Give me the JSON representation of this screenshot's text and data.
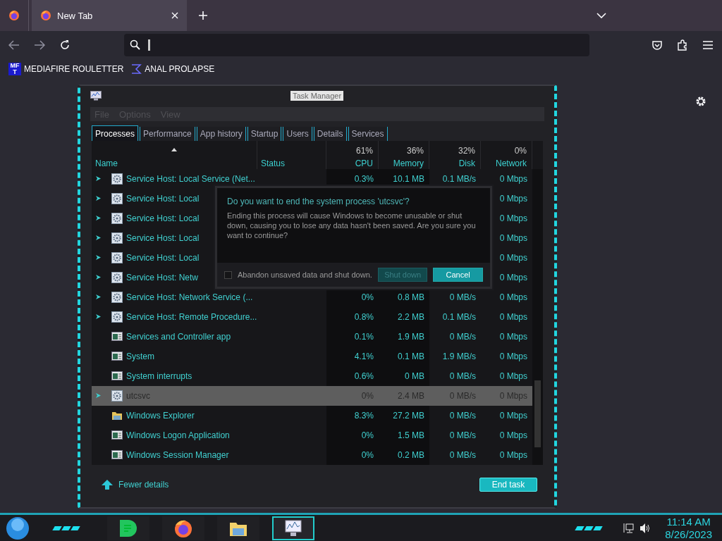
{
  "browser": {
    "tabs": [
      {
        "label": "New Tab",
        "selected": true
      }
    ],
    "bookmarks": [
      {
        "label": "MEDIAFIRE ROULETTER",
        "kind": "mft",
        "icon_text": [
          "MF",
          "T"
        ]
      },
      {
        "label": "ANAL PROLAPSE",
        "kind": "sigma"
      }
    ]
  },
  "task_manager": {
    "title": "Task Manager",
    "menu": [
      "File",
      "Options",
      "View"
    ],
    "tabs": [
      {
        "label": "Processes",
        "selected": true
      },
      {
        "label": "Performance",
        "selected": false
      },
      {
        "label": "App history",
        "selected": false
      },
      {
        "label": "Startup",
        "selected": false
      },
      {
        "label": "Users",
        "selected": false
      },
      {
        "label": "Details",
        "selected": false
      },
      {
        "label": "Services",
        "selected": false
      }
    ],
    "columns": [
      {
        "label": "Name",
        "sorted": true
      },
      {
        "label": "Status",
        "sorted": false
      },
      {
        "label": "CPU",
        "usage": "61%",
        "sorted": false
      },
      {
        "label": "Memory",
        "usage": "36%",
        "sorted": false
      },
      {
        "label": "Disk",
        "usage": "32%",
        "sorted": false
      },
      {
        "label": "Network",
        "usage": "0%",
        "sorted": false
      }
    ],
    "rows": [
      {
        "name": "Service Host: Local Service (Net...",
        "kind": "service",
        "expandable": true,
        "selected": false,
        "cpu": "0.3%",
        "memory": "10.1 MB",
        "disk": "0.1 MB/s",
        "network": "0 Mbps"
      },
      {
        "name": "Service Host: Local",
        "kind": "service",
        "expandable": true,
        "selected": false,
        "network": "0 Mbps"
      },
      {
        "name": "Service Host: Local",
        "kind": "service",
        "expandable": true,
        "selected": false,
        "network": "0 Mbps"
      },
      {
        "name": "Service Host: Local",
        "kind": "service",
        "expandable": true,
        "selected": false,
        "network": "0 Mbps"
      },
      {
        "name": "Service Host: Local",
        "kind": "service",
        "expandable": true,
        "selected": false,
        "network": "0 Mbps"
      },
      {
        "name": "Service Host: Netw",
        "kind": "service",
        "expandable": true,
        "selected": false,
        "network": "0 Mbps"
      },
      {
        "name": "Service Host: Network Service (...",
        "kind": "service",
        "expandable": true,
        "selected": false,
        "cpu": "0%",
        "memory": "0.8 MB",
        "disk": "0 MB/s",
        "network": "0 Mbps"
      },
      {
        "name": "Service Host: Remote Procedure...",
        "kind": "service",
        "expandable": true,
        "selected": false,
        "cpu": "0.8%",
        "memory": "2.2 MB",
        "disk": "0.1 MB/s",
        "network": "0 Mbps"
      },
      {
        "name": "Services and Controller app",
        "kind": "app",
        "expandable": false,
        "selected": false,
        "cpu": "0.1%",
        "memory": "1.9 MB",
        "disk": "0 MB/s",
        "network": "0 Mbps"
      },
      {
        "name": "System",
        "kind": "app",
        "expandable": false,
        "selected": false,
        "cpu": "4.1%",
        "memory": "0.1 MB",
        "disk": "1.9 MB/s",
        "network": "0 Mbps"
      },
      {
        "name": "System interrupts",
        "kind": "app",
        "expandable": false,
        "selected": false,
        "cpu": "0.6%",
        "memory": "0 MB",
        "disk": "0 MB/s",
        "network": "0 Mbps"
      },
      {
        "name": "utcsvc",
        "kind": "service",
        "expandable": true,
        "selected": true,
        "cpu": "0%",
        "memory": "2.4 MB",
        "disk": "0 MB/s",
        "network": "0 Mbps"
      },
      {
        "name": "Windows Explorer",
        "kind": "folder",
        "expandable": false,
        "selected": false,
        "cpu": "8.3%",
        "memory": "27.2 MB",
        "disk": "0 MB/s",
        "network": "0 Mbps"
      },
      {
        "name": "Windows Logon Application",
        "kind": "app",
        "expandable": false,
        "selected": false,
        "cpu": "0%",
        "memory": "1.5 MB",
        "disk": "0 MB/s",
        "network": "0 Mbps"
      },
      {
        "name": "Windows Session Manager",
        "kind": "app",
        "expandable": false,
        "selected": false,
        "cpu": "0%",
        "memory": "0.2 MB",
        "disk": "0 MB/s",
        "network": "0 Mbps"
      }
    ],
    "dialog": {
      "title": "Do you want to end the system process 'utcsvc'?",
      "message": "Ending this process will cause Windows to become unusable or shut down, causing you to lose any data hasn't been saved. Are you sure you want to continue?",
      "checkbox": {
        "label": "Abandon unsaved data and shut down.",
        "checked": false
      },
      "buttons": [
        {
          "label": "Shut down",
          "disabled": true
        },
        {
          "label": "Cancel",
          "disabled": false
        }
      ]
    },
    "fewer_details": "Fewer details",
    "end_task": "End task"
  },
  "taskbar": {
    "apps": [
      {
        "kind": "notes",
        "selected": false
      },
      {
        "kind": "firefox",
        "selected": false
      },
      {
        "kind": "explorer",
        "selected": false
      },
      {
        "kind": "taskmgr",
        "selected": true
      }
    ],
    "time": "11:14 AM",
    "date": "8/26/2023"
  }
}
